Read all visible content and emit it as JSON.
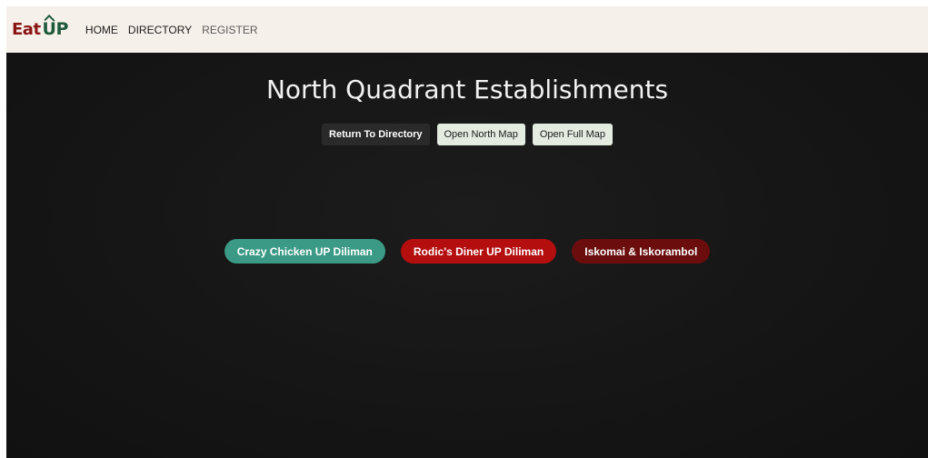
{
  "nav": {
    "logo_eat": "Eat",
    "logo_up": "UP",
    "links": [
      "HOME",
      "DIRECTORY",
      "REGISTER"
    ]
  },
  "main": {
    "title": "North Quadrant Establishments",
    "buttons": [
      "Return To Directory",
      "Open North Map",
      "Open Full Map"
    ],
    "establishments": [
      {
        "name": "Crazy Chicken UP Diliman",
        "color": "#3a9a86"
      },
      {
        "name": "Rodic's Diner UP Diliman",
        "color": "#b50e0e"
      },
      {
        "name": "Iskomai & Iskorambol",
        "color": "#6b0d0d"
      }
    ]
  },
  "colors": {
    "navbar_bg": "#f6f0ea",
    "main_bg": "#161616",
    "logo_red": "#8a1414",
    "logo_green": "#1e5a3a"
  }
}
